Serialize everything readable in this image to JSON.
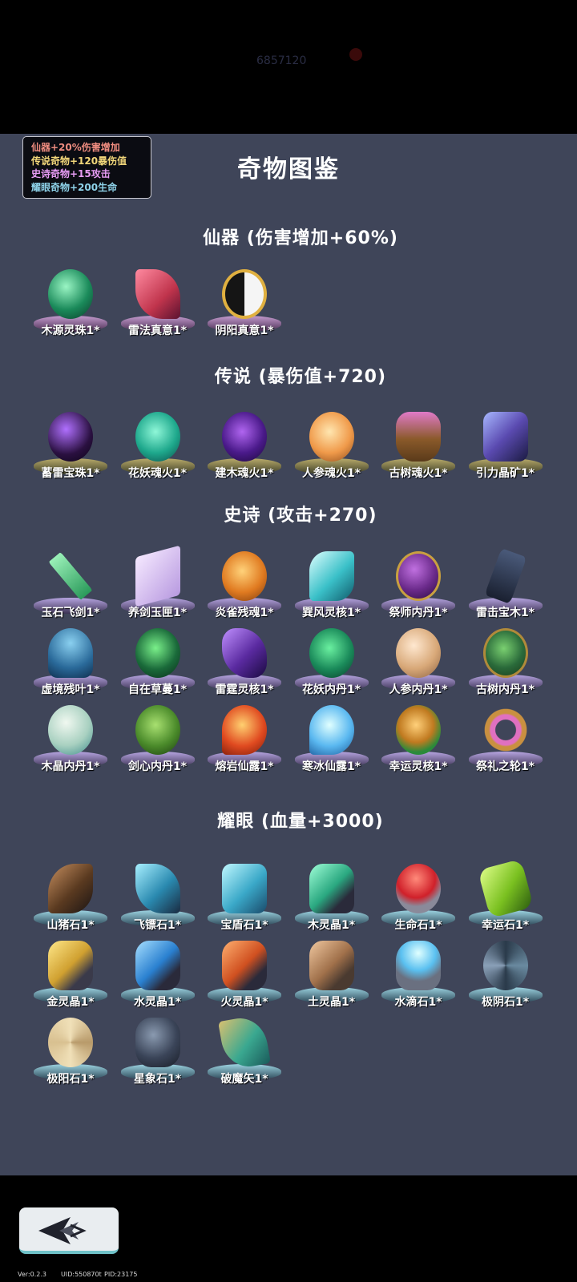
{
  "header": {
    "faded_text": "6857120"
  },
  "bonus_box": {
    "lines": [
      "仙器+20%伤害增加",
      "传说奇物+120暴伤值",
      "史诗奇物+15攻击",
      "耀眼奇物+200生命"
    ]
  },
  "page_title": "奇物图鉴",
  "sections": [
    {
      "title": "仙器 (伤害增加+60%)",
      "items": [
        "木源灵珠1*",
        "雷法真意1*",
        "阴阳真意1*"
      ]
    },
    {
      "title": "传说 (暴伤值+720)",
      "items": [
        "蓄雷宝珠1*",
        "花妖魂火1*",
        "建木魂火1*",
        "人参魂火1*",
        "古树魂火1*",
        "引力晶矿1*"
      ]
    },
    {
      "title": "史诗 (攻击+270)",
      "items": [
        "玉石飞剑1*",
        "养剑玉匣1*",
        "炎雀残魂1*",
        "巽风灵核1*",
        "祭师内丹1*",
        "雷击宝木1*",
        "虚境残叶1*",
        "自在草蔓1*",
        "雷霆灵核1*",
        "花妖内丹1*",
        "人参内丹1*",
        "古树内丹1*",
        "木晶内丹1*",
        "剑心内丹1*",
        "熔岩仙露1*",
        "寒冰仙露1*",
        "幸运灵核1*",
        "祭礼之轮1*"
      ]
    },
    {
      "title": "耀眼 (血量+3000)",
      "items": [
        "山猪石1*",
        "飞镖石1*",
        "宝盾石1*",
        "木灵晶1*",
        "生命石1*",
        "幸运石1*",
        "金灵晶1*",
        "水灵晶1*",
        "火灵晶1*",
        "土灵晶1*",
        "水滴石1*",
        "极阴石1*",
        "极阳石1*",
        "星象石1*",
        "破魔矢1*"
      ]
    }
  ],
  "footer": {
    "version": "Ver:0.2.3",
    "uid": "UID:550870t",
    "pid": "PID:23175"
  }
}
